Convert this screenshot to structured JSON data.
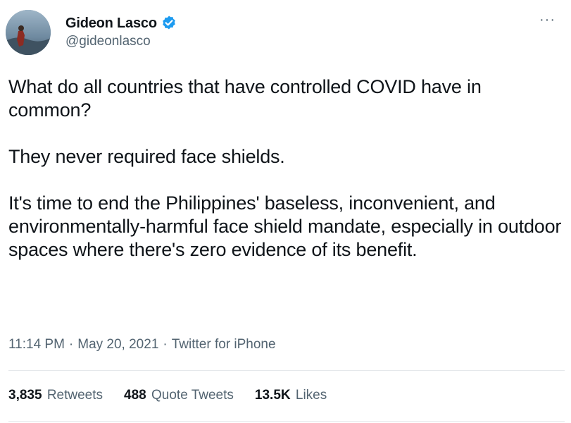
{
  "author": {
    "display_name": "Gideon Lasco",
    "handle": "@gideonlasco",
    "verified": true
  },
  "menu_icon": "more-horizontal-icon",
  "body": {
    "para1": "What do all countries that have controlled COVID have in common?",
    "para2": "They never required face shields.",
    "para3": "It's time to end the Philippines' baseless, inconvenient, and environmentally-harmful face shield mandate, especially in outdoor spaces where there's zero evidence of its benefit."
  },
  "meta": {
    "time": "11:14 PM",
    "separator": "·",
    "date": "May 20, 2021",
    "source": "Twitter for iPhone"
  },
  "stats": {
    "retweets_count": "3,835",
    "retweets_label": "Retweets",
    "quotes_count": "488",
    "quotes_label": "Quote Tweets",
    "likes_count": "13.5K",
    "likes_label": "Likes"
  },
  "colors": {
    "verified_blue": "#1d9bf0",
    "secondary_text": "#536471",
    "primary_text": "#0f1419"
  }
}
